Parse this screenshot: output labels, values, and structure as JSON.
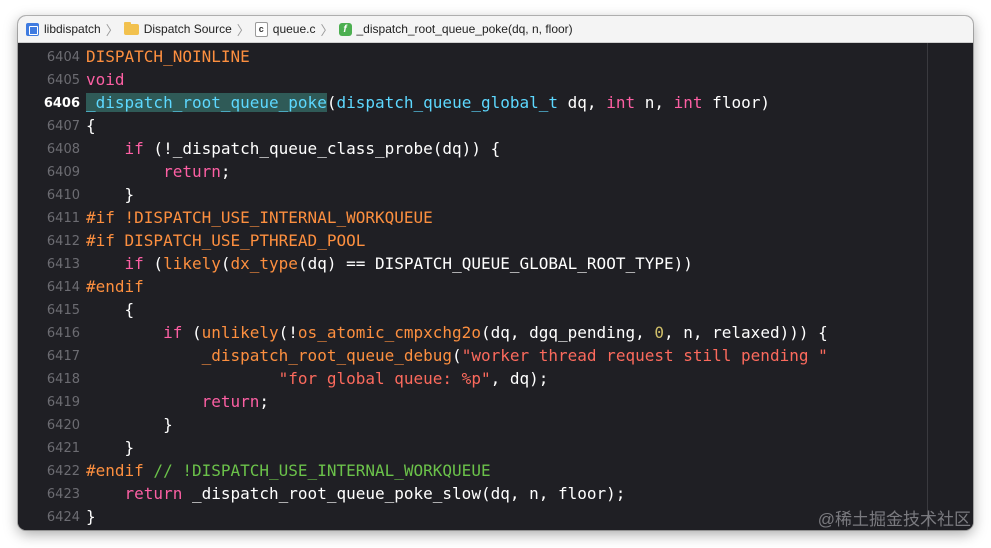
{
  "breadcrumbs": [
    {
      "label": "libdispatch",
      "icon": "project-icon"
    },
    {
      "label": "Dispatch Source",
      "icon": "folder-icon"
    },
    {
      "label": "queue.c",
      "icon": "c-file-icon"
    },
    {
      "label": "_dispatch_root_queue_poke(dq, n, floor)",
      "icon": "function-icon"
    }
  ],
  "colors": {
    "background": "#1f1f24",
    "keyword": "#fc5fa3",
    "macro": "#fd8f3f",
    "type": "#5dd8ff",
    "string": "#fc6a5d",
    "number": "#d0bf69",
    "comment": "#6bc24a"
  },
  "editor": {
    "current_line": "6406",
    "lines": [
      {
        "num": "6404",
        "tokens": [
          {
            "t": "DISPATCH_NOINLINE",
            "c": "macro"
          }
        ]
      },
      {
        "num": "6405",
        "tokens": [
          {
            "t": "void",
            "c": "kw"
          }
        ]
      },
      {
        "num": "6406",
        "tokens": [
          {
            "t": "_dispatch_root_queue_poke",
            "c": "hl"
          },
          {
            "t": "(",
            "c": "plain"
          },
          {
            "t": "dispatch_queue_global_t",
            "c": "type"
          },
          {
            "t": " dq, ",
            "c": "plain"
          },
          {
            "t": "int",
            "c": "kw"
          },
          {
            "t": " n, ",
            "c": "plain"
          },
          {
            "t": "int",
            "c": "kw"
          },
          {
            "t": " floor)",
            "c": "plain"
          }
        ]
      },
      {
        "num": "6407",
        "tokens": [
          {
            "t": "{",
            "c": "plain"
          }
        ]
      },
      {
        "num": "6408",
        "tokens": [
          {
            "t": "    ",
            "c": "plain"
          },
          {
            "t": "if",
            "c": "kw"
          },
          {
            "t": " (!_dispatch_queue_class_probe(dq)) {",
            "c": "plain"
          }
        ]
      },
      {
        "num": "6409",
        "tokens": [
          {
            "t": "        ",
            "c": "plain"
          },
          {
            "t": "return",
            "c": "kw"
          },
          {
            "t": ";",
            "c": "plain"
          }
        ]
      },
      {
        "num": "6410",
        "tokens": [
          {
            "t": "    }",
            "c": "plain"
          }
        ]
      },
      {
        "num": "6411",
        "tokens": [
          {
            "t": "#if !DISPATCH_USE_INTERNAL_WORKQUEUE",
            "c": "pp"
          }
        ]
      },
      {
        "num": "6412",
        "tokens": [
          {
            "t": "#if DISPATCH_USE_PTHREAD_POOL",
            "c": "pp"
          }
        ]
      },
      {
        "num": "6413",
        "tokens": [
          {
            "t": "    ",
            "c": "plain"
          },
          {
            "t": "if",
            "c": "kw"
          },
          {
            "t": " (",
            "c": "plain"
          },
          {
            "t": "likely",
            "c": "macro"
          },
          {
            "t": "(",
            "c": "plain"
          },
          {
            "t": "dx_type",
            "c": "macro"
          },
          {
            "t": "(dq) == DISPATCH_QUEUE_GLOBAL_ROOT_TYPE))",
            "c": "plain"
          }
        ]
      },
      {
        "num": "6414",
        "tokens": [
          {
            "t": "#endif",
            "c": "pp"
          }
        ]
      },
      {
        "num": "6415",
        "tokens": [
          {
            "t": "    {",
            "c": "plain"
          }
        ]
      },
      {
        "num": "6416",
        "tokens": [
          {
            "t": "        ",
            "c": "plain"
          },
          {
            "t": "if",
            "c": "kw"
          },
          {
            "t": " (",
            "c": "plain"
          },
          {
            "t": "unlikely",
            "c": "macro"
          },
          {
            "t": "(!",
            "c": "plain"
          },
          {
            "t": "os_atomic_cmpxchg2o",
            "c": "macro"
          },
          {
            "t": "(dq, dgq_pending, ",
            "c": "plain"
          },
          {
            "t": "0",
            "c": "num"
          },
          {
            "t": ", n, relaxed))) {",
            "c": "plain"
          }
        ]
      },
      {
        "num": "6417",
        "tokens": [
          {
            "t": "            ",
            "c": "plain"
          },
          {
            "t": "_dispatch_root_queue_debug",
            "c": "macro"
          },
          {
            "t": "(",
            "c": "plain"
          },
          {
            "t": "\"worker thread request still pending \"",
            "c": "str"
          }
        ]
      },
      {
        "num": "6418",
        "tokens": [
          {
            "t": "                    ",
            "c": "plain"
          },
          {
            "t": "\"for global queue: %p\"",
            "c": "str"
          },
          {
            "t": ", dq);",
            "c": "plain"
          }
        ]
      },
      {
        "num": "6419",
        "tokens": [
          {
            "t": "            ",
            "c": "plain"
          },
          {
            "t": "return",
            "c": "kw"
          },
          {
            "t": ";",
            "c": "plain"
          }
        ]
      },
      {
        "num": "6420",
        "tokens": [
          {
            "t": "        }",
            "c": "plain"
          }
        ]
      },
      {
        "num": "6421",
        "tokens": [
          {
            "t": "    }",
            "c": "plain"
          }
        ]
      },
      {
        "num": "6422",
        "tokens": [
          {
            "t": "#endif",
            "c": "pp"
          },
          {
            "t": " // !DISPATCH_USE_INTERNAL_WORKQUEUE",
            "c": "cmt"
          }
        ]
      },
      {
        "num": "6423",
        "tokens": [
          {
            "t": "    ",
            "c": "plain"
          },
          {
            "t": "return",
            "c": "kw"
          },
          {
            "t": " _dispatch_root_queue_poke_slow(dq, n, floor);",
            "c": "plain"
          }
        ]
      },
      {
        "num": "6424",
        "tokens": [
          {
            "t": "}",
            "c": "plain"
          }
        ]
      }
    ]
  },
  "watermark": "@稀土掘金技术社区"
}
